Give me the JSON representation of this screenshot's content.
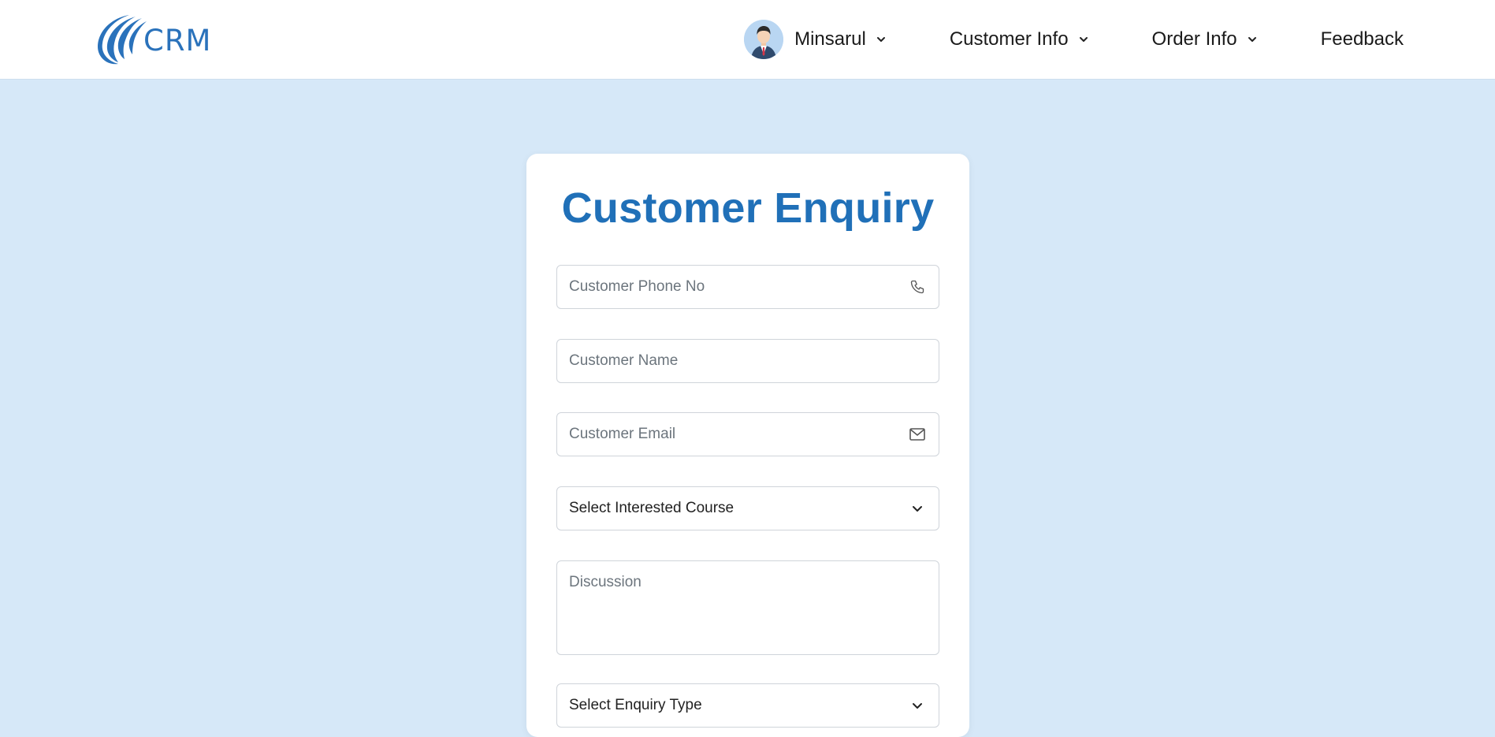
{
  "brand": {
    "logo_text": "CRM",
    "accent": "#2a72bb"
  },
  "nav": {
    "user": {
      "name": "Minsarul",
      "avatar_icon": "user-avatar-icon"
    },
    "customer_info": "Customer Info",
    "order_info": "Order Info",
    "feedback": "Feedback"
  },
  "form": {
    "title": "Customer Enquiry",
    "title_color": "#2070b8",
    "phone": {
      "placeholder": "Customer Phone No",
      "value": "",
      "icon": "phone-icon"
    },
    "name": {
      "placeholder": "Customer Name",
      "value": ""
    },
    "email": {
      "placeholder": "Customer Email",
      "value": "",
      "icon": "mail-icon"
    },
    "course": {
      "selected": "Select Interested Course"
    },
    "discussion": {
      "placeholder": "Discussion",
      "value": ""
    },
    "enquiry_type": {
      "selected": "Select Enquiry Type"
    }
  },
  "colors": {
    "page_background": "#d6e8f8",
    "card_background": "#ffffff",
    "border": "#cfd4da"
  }
}
